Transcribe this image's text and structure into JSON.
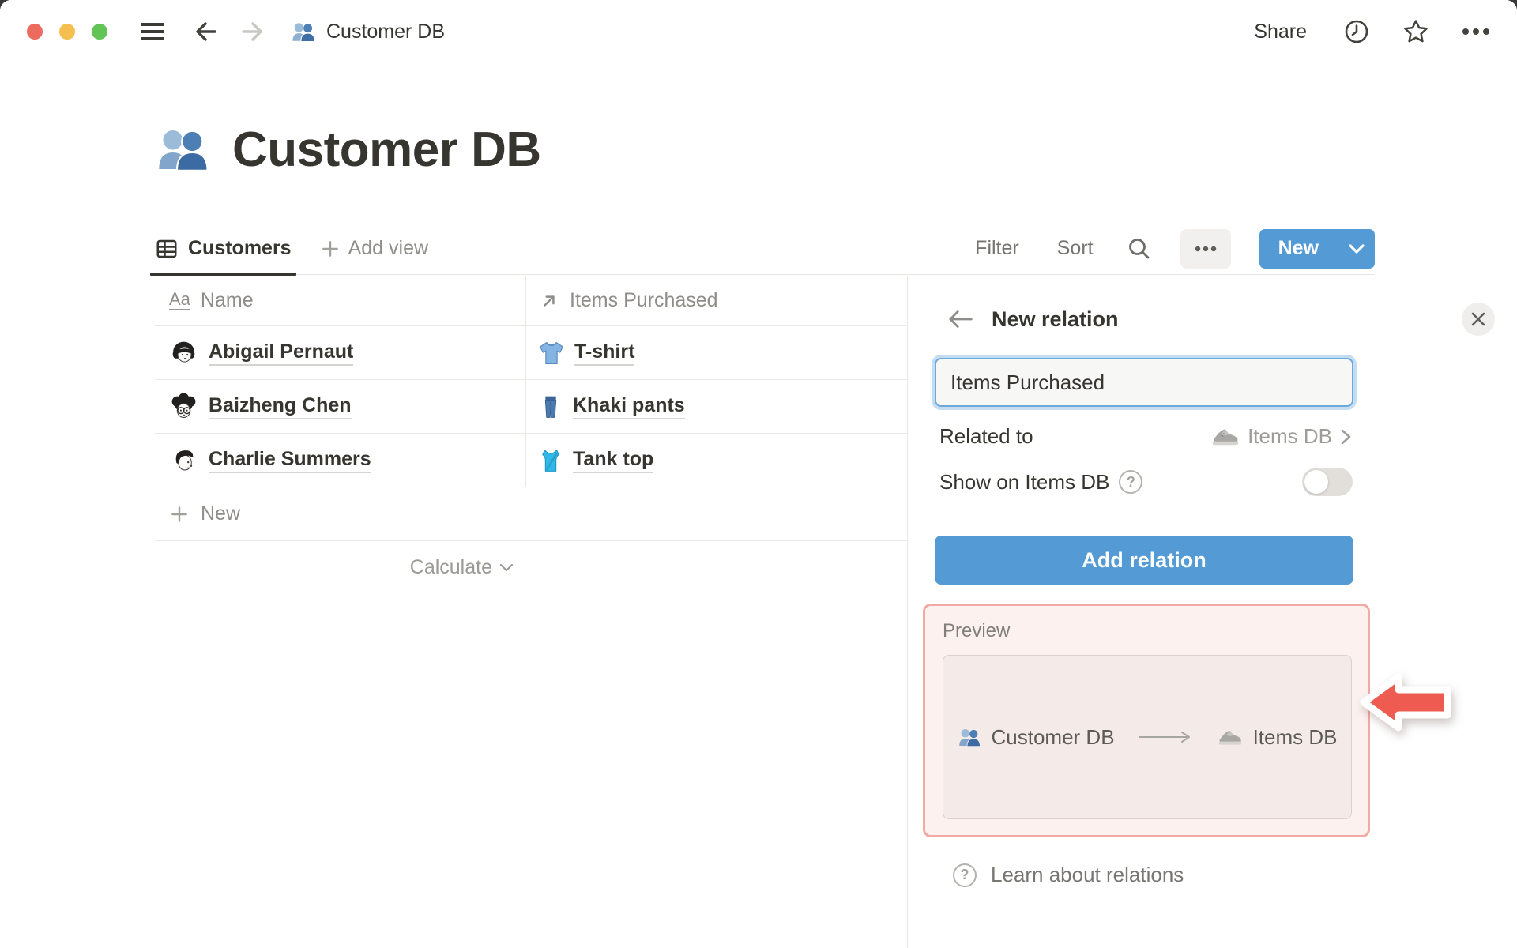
{
  "titlebar": {
    "doc_title": "Customer DB",
    "share_label": "Share"
  },
  "page": {
    "title": "Customer DB"
  },
  "toolbar": {
    "view_tab": "Customers",
    "add_view": "Add view",
    "filter": "Filter",
    "sort": "Sort",
    "new_button": "New"
  },
  "table": {
    "columns": [
      {
        "label": "Name"
      },
      {
        "label": "Items Purchased"
      }
    ],
    "rows": [
      {
        "name": "Abigail Pernaut",
        "item": "T-shirt"
      },
      {
        "name": "Baizheng Chen",
        "item": "Khaki pants"
      },
      {
        "name": "Charlie Summers",
        "item": "Tank top"
      }
    ],
    "new_row_label": "New",
    "calculate_label": "Calculate"
  },
  "panel": {
    "title": "New relation",
    "name_input_value": "Items Purchased",
    "related_to_label": "Related to",
    "related_to_value": "Items DB",
    "show_on_label": "Show on Items DB",
    "add_button_label": "Add relation",
    "preview": {
      "label": "Preview",
      "source": "Customer DB",
      "target": "Items DB"
    },
    "learn_label": "Learn about relations"
  },
  "icons": {
    "help_glyph": "?",
    "text_property_glyph": "Aa",
    "people_icon": "two blue busts silhouette",
    "tshirt_icon": "blue t-shirt",
    "jeans_icon": "blue khaki pants",
    "tanktop_icon": "cyan tank top",
    "sneaker_icon": "gray running shoe",
    "relation_icon": "north-east arrow"
  },
  "colors": {
    "accent_blue": "#549bd5",
    "text_dark": "#37352f",
    "pink_highlight_bg": "#fdf1ef",
    "pink_highlight_border": "#f2aba4",
    "annotation_arrow_red": "#ee5b50"
  }
}
